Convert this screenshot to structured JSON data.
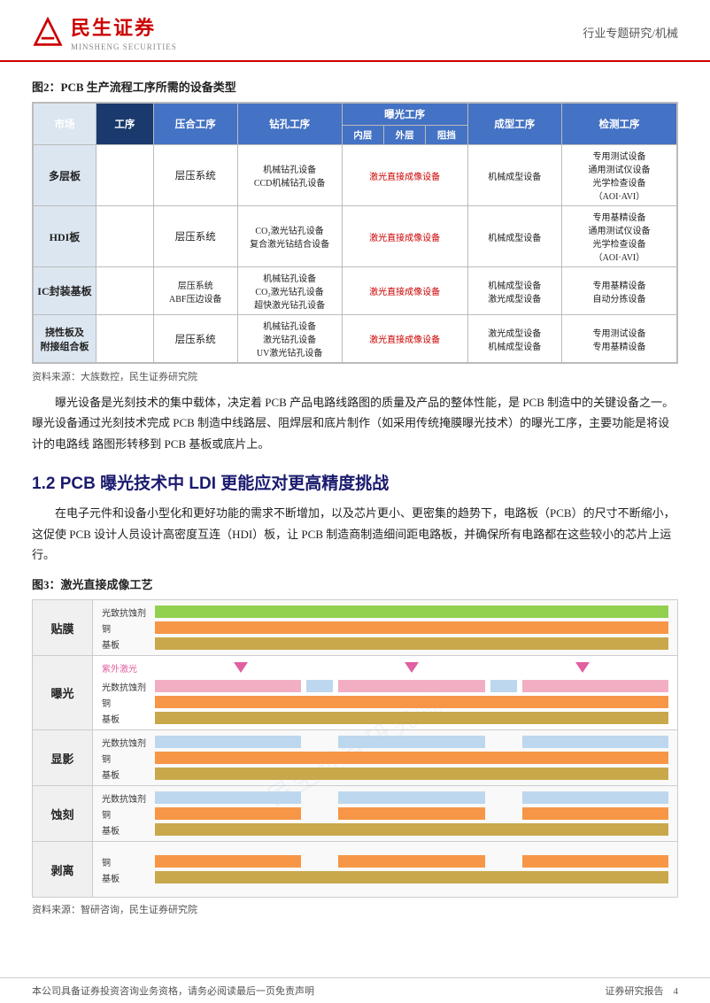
{
  "header": {
    "logo_cn": "民生证券",
    "logo_en": "MINSHENG SECURITIES",
    "right_text": "行业专题研究/机械"
  },
  "figure2": {
    "title": "图2：PCB 生产流程工序所需的设备类型",
    "table": {
      "headers": {
        "market": "市场",
        "process": "工序",
        "col1": "压合工序",
        "col2": "钻孔工序",
        "col3_top": "曝光工序",
        "col3_sub1": "内层",
        "col3_sub2": "外层",
        "col3_sub3": "阻挡",
        "col4": "成型工序",
        "col5": "检测工序"
      },
      "rows": [
        {
          "market": "多层板",
          "col1": "层压系统",
          "col2": "机械钻孔设备\nCCD机械钻孔设备",
          "col3": "激光直接成像设备",
          "col4": "机械成型设备",
          "col5": "专用测试设备\n通用测试仪设备\n光学检查设备\n（AOI·AVI）"
        },
        {
          "market": "HDI板",
          "col1": "层压系统",
          "col2": "CO₂激光钻孔设备\n复合激光钻结合设备",
          "col3": "激光直接成像设备",
          "col4": "机械成型设备",
          "col5": "专用基精设备\n通用测试仪设备\n光学检查设备\n（AOI·AVI）"
        },
        {
          "market": "IC封装基板",
          "col1": "层压系统\nABF压边设备",
          "col2": "机械钻孔设备\nCO₂激光钻孔设备\n超快激光钻孔设备",
          "col3": "激光直接成像设备",
          "col4": "机械成型设备\n激光成型设备",
          "col5": "专用基精设备\n自动分拣设备"
        },
        {
          "market": "挠性板及附接组合板",
          "col1": "层压系统",
          "col2": "机械钻孔设备\n激光钻孔设备\nUV激光钻孔设备",
          "col3": "激光直接成像设备",
          "col4": "激光成型设备\n机械成型设备",
          "col5": "专用测试设备\n专用基精设备"
        }
      ]
    },
    "source": "资料来源：大族数控，民生证券研究院"
  },
  "body_text1": "曝光设备是光刻技术的集中载体，决定着 PCB 产品电路线路图的质量及产品的整体性能，是 PCB 制造中的关键设备之一。曝光设备通过光刻技术完成 PCB 制造中线路层、阻焊层和底片制作（如采用传统掩膜曝光技术）的曝光工序，主要功能是将设计的电路线 路图形转移到 PCB 基板或底片上。",
  "heading12": {
    "text": "1.2 PCB 曝光技术中 LDI 更能应对更高精度挑战"
  },
  "body_text2": "在电子元件和设备小型化和更好功能的需求不断增加，以及芯片更小、更密集的趋势下，电路板（PCB）的尺寸不断缩小，这促使 PCB 设计人员设计高密度互连（HDI）板，让 PCB 制造商制造细间距电路板，并确保所有电路都在这些较小的芯片上运行。",
  "figure3": {
    "title": "图3：激光直接成像工艺",
    "rows": [
      {
        "label": "贴膜",
        "layers": [
          {
            "name": "光致抗蚀剂",
            "color": "green"
          },
          {
            "name": "铜",
            "color": "orange"
          },
          {
            "name": "基板",
            "color": "gold"
          }
        ]
      },
      {
        "label": "曝光",
        "layers": [
          {
            "name": "光数抗蚀剂",
            "color": "pink"
          },
          {
            "name": "铜",
            "color": "orange"
          },
          {
            "name": "基板",
            "color": "gold"
          }
        ],
        "has_uv": true,
        "uv_label": "紫外激光"
      },
      {
        "label": "显影",
        "layers": [
          {
            "name": "光数抗蚀剂",
            "color": "blue_light"
          },
          {
            "name": "铜",
            "color": "orange"
          },
          {
            "name": "基板",
            "color": "gold"
          }
        ]
      },
      {
        "label": "蚀刻",
        "layers": [
          {
            "name": "光数抗蚀剂",
            "color": "blue_light"
          },
          {
            "name": "铜",
            "color": "orange"
          },
          {
            "name": "基板",
            "color": "gold"
          }
        ]
      },
      {
        "label": "剥离",
        "layers": [
          {
            "name": "铜",
            "color": "orange"
          },
          {
            "name": "基板",
            "color": "gold"
          }
        ]
      }
    ],
    "source": "资料来源：智研咨询，民生证券研究院"
  },
  "footer": {
    "left": "本公司具备证券投资咨询业务资格，请务必阅读最后一页免责声明",
    "right": "证券研究报告",
    "page": "4"
  }
}
